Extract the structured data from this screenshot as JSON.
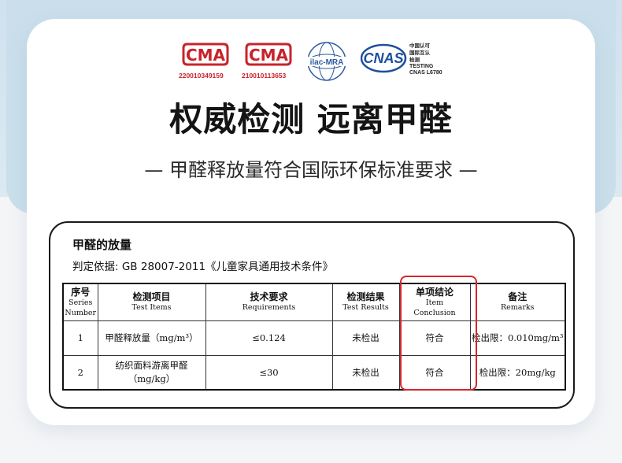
{
  "certifications": [
    {
      "mark": "CMA",
      "number": "220010349159",
      "color": "#c8232b"
    },
    {
      "mark": "CMA",
      "number": "210010113653",
      "color": "#c8232b"
    },
    {
      "mark": "ilac-MRA",
      "color": "#2c5aa0"
    },
    {
      "mark": "CNAS",
      "lines": [
        "中国认可",
        "国际互认",
        "检测",
        "TESTING",
        "CNAS L6780"
      ],
      "color": "#1d4f9c"
    }
  ],
  "headline": "权威检测 远离甲醛",
  "subheadline": "— 甲醛释放量符合国际环保标准要求 —",
  "report": {
    "title": "甲醛的放量",
    "basis": "判定依据: GB 28007-2011《儿童家具通用技术条件》",
    "columns": [
      {
        "cn": "序号",
        "en": [
          "Series",
          "Number"
        ]
      },
      {
        "cn": "检测项目",
        "en": [
          "Test Items"
        ]
      },
      {
        "cn": "技术要求",
        "en": [
          "Requirements"
        ]
      },
      {
        "cn": "检测结果",
        "en": [
          "Test Results"
        ]
      },
      {
        "cn": "单项结论",
        "en": [
          "Item",
          "Conclusion"
        ]
      },
      {
        "cn": "备注",
        "en": [
          "Remarks"
        ]
      }
    ],
    "rows": [
      {
        "no": "1",
        "item": "甲醛释放量（mg/m³）",
        "requirement": "≤0.124",
        "result": "未检出",
        "conclusion": "符合",
        "remarks": "检出限：0.010mg/m³"
      },
      {
        "no": "2",
        "item": "纺织面料游离甲醛",
        "item_unit": "（mg/kg）",
        "requirement": "≤30",
        "result": "未检出",
        "conclusion": "符合",
        "remarks": "检出限：20mg/kg"
      }
    ]
  },
  "colors": {
    "accent_red": "#d7252c",
    "bg_blue": "#cadfeb"
  }
}
